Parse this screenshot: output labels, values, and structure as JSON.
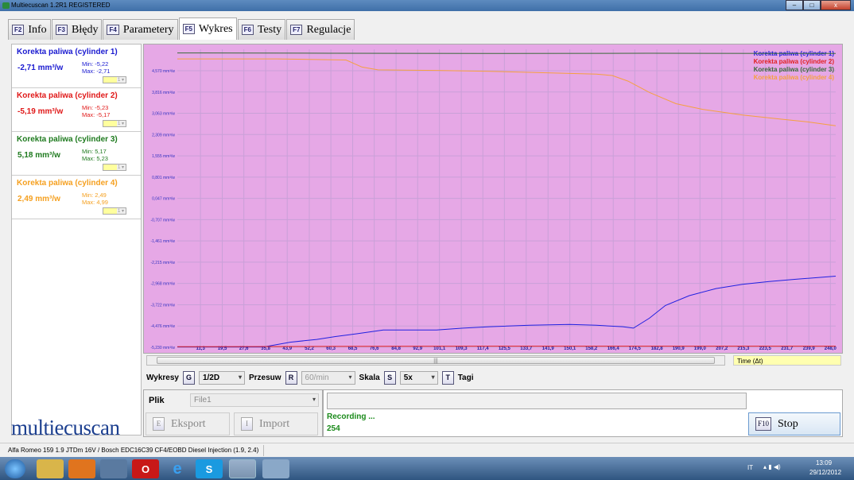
{
  "window": {
    "title": "Multiecuscan 1.2R1 REGISTERED",
    "minimize": "–",
    "maximize": "□",
    "close": "x"
  },
  "tabs": [
    {
      "key": "F2",
      "label": "Info"
    },
    {
      "key": "F3",
      "label": "Błędy"
    },
    {
      "key": "F4",
      "label": "Parametery"
    },
    {
      "key": "F5",
      "label": "Wykres",
      "active": true
    },
    {
      "key": "F6",
      "label": "Testy"
    },
    {
      "key": "F7",
      "label": "Regulacje"
    }
  ],
  "parameters": [
    {
      "name": "Korekta paliwa (cylinder 1)",
      "value": "-2,71 mm³/w",
      "min": "Min: -5,22",
      "max": "Max: -2,71",
      "select": "1",
      "color": "#1a1ad0"
    },
    {
      "name": "Korekta paliwa (cylinder 2)",
      "value": "-5,19 mm³/w",
      "min": "Min: -5,23",
      "max": "Max: -5,17",
      "select": "1",
      "color": "#e01818"
    },
    {
      "name": "Korekta paliwa (cylinder 3)",
      "value": "5,18 mm³/w",
      "min": "Min: 5,17",
      "max": "Max: 5,23",
      "select": "1",
      "color": "#1e7a1e"
    },
    {
      "name": "Korekta paliwa (cylinder 4)",
      "value": "2,49 mm³/w",
      "min": "Min: 2,49",
      "max": "Max: 4,99",
      "select": "1",
      "color": "#f5a020"
    }
  ],
  "logo": "multiecuscan",
  "chart_data": {
    "type": "line",
    "background": "#e6a8e6",
    "xlabel": "Time (Δt)",
    "xlim": [
      2.6,
      250
    ],
    "ylim": [
      -5.33,
      5.33
    ],
    "x_ticks": [
      "11,3",
      "19,5",
      "27,6",
      "35,8",
      "43,9",
      "52,2",
      "60,3",
      "68,5",
      "76,6",
      "84,8",
      "92,9",
      "101,1",
      "109,3",
      "117,4",
      "125,5",
      "133,7",
      "141,9",
      "150,1",
      "158,2",
      "166,4",
      "174,5",
      "182,8",
      "190,9",
      "199,0",
      "207,2",
      "215,3",
      "223,5",
      "231,7",
      "239,9",
      "248,0"
    ],
    "y_ticks": [
      "4,570 mm³/w",
      "3,816 mm³/w",
      "3,063 mm³/w",
      "2,309 mm³/w",
      "1,555 mm³/w",
      "0,801 mm³/w",
      "0,047 mm³/w",
      "-0,707 mm³/w",
      "-1,461 mm³/w",
      "-2,215 mm³/w",
      "-2,968 mm³/w",
      "-3,722 mm³/w",
      "-4,476 mm³/w",
      "-5,230 mm³/w"
    ],
    "y_tick_values": [
      4.57,
      3.816,
      3.063,
      2.309,
      1.555,
      0.801,
      0.047,
      -0.707,
      -1.461,
      -2.215,
      -2.968,
      -3.722,
      -4.476,
      -5.23
    ],
    "legend_position": "top-right",
    "series": [
      {
        "name": "Korekta paliwa (cylinder 1)",
        "color": "#2020e0",
        "x": [
          2.6,
          35,
          45,
          55,
          62,
          70,
          80,
          90,
          100,
          110,
          120,
          135,
          150,
          160,
          170,
          174,
          180,
          186,
          195,
          205,
          215,
          225,
          235,
          250
        ],
        "y": [
          -5.22,
          -5.22,
          -5.05,
          -4.95,
          -4.85,
          -4.75,
          -4.62,
          -4.62,
          -4.62,
          -4.55,
          -4.5,
          -4.45,
          -4.42,
          -4.45,
          -4.5,
          -4.55,
          -4.2,
          -3.75,
          -3.4,
          -3.15,
          -3.0,
          -2.9,
          -2.82,
          -2.71
        ]
      },
      {
        "name": "Korekta paliwa (cylinder 2)",
        "color": "#e02020",
        "x": [
          2.6,
          60,
          120,
          180,
          250
        ],
        "y": [
          -5.21,
          -5.2,
          -5.19,
          -5.19,
          -5.19
        ]
      },
      {
        "name": "Korekta paliwa (cylinder 3)",
        "color": "#3a6a3a",
        "x": [
          2.6,
          60,
          120,
          180,
          250
        ],
        "y": [
          5.2,
          5.19,
          5.18,
          5.19,
          5.18
        ]
      },
      {
        "name": "Korekta paliwa (cylinder 4)",
        "color": "#f5a040",
        "x": [
          2.6,
          40,
          66,
          72,
          78,
          100,
          120,
          140,
          160,
          166,
          172,
          180,
          190,
          200,
          215,
          230,
          240,
          250
        ],
        "y": [
          4.99,
          4.99,
          4.95,
          4.7,
          4.6,
          4.58,
          4.55,
          4.5,
          4.45,
          4.4,
          4.2,
          3.8,
          3.4,
          3.2,
          3.0,
          2.85,
          2.75,
          2.62
        ]
      }
    ]
  },
  "controls": {
    "wykresy": "Wykresy",
    "g": "G",
    "wykresy_value": "1/2D",
    "przesuw": "Przesuw",
    "r": "R",
    "przesuw_value": "60/min",
    "skala": "Skala",
    "s": "S",
    "skala_value": "5x",
    "t": "T",
    "tagi": "Tagi"
  },
  "file": {
    "label": "Plik",
    "value": "File1",
    "export_key": "E",
    "export": "Eksport",
    "import_key": "I",
    "import": "Import"
  },
  "recording": {
    "status": "Recording ...",
    "count": "254",
    "stop_key": "F10",
    "stop": "Stop"
  },
  "statusbar": "Alfa Romeo 159 1.9 JTDm 16V / Bosch EDC16C39 CF4/EOBD Diesel Injection (1.9, 2.4)",
  "taskbar": {
    "lang": "IT",
    "time": "13:09",
    "date": "29/12/2012"
  }
}
